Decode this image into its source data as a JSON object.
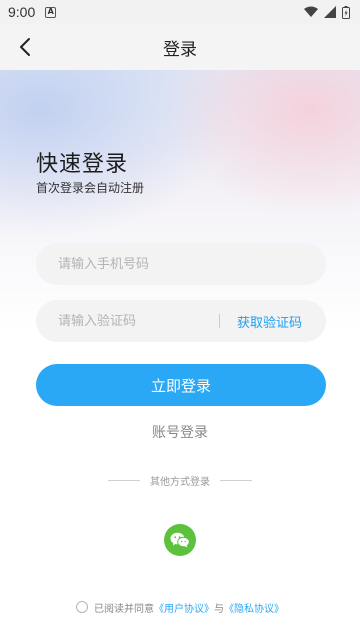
{
  "status_bar": {
    "time": "9:00",
    "notification_glyph": "A"
  },
  "nav": {
    "title": "登录"
  },
  "header": {
    "title": "快速登录",
    "subtitle": "首次登录会自动注册"
  },
  "form": {
    "phone_placeholder": "请输入手机号码",
    "code_placeholder": "请输入验证码",
    "get_code_label": "获取验证码",
    "submit_label": "立即登录",
    "account_login_label": "账号登录"
  },
  "other_login": {
    "label": "其他方式登录"
  },
  "agreement": {
    "prefix": "已阅读并同意",
    "user_agreement": "《用户协议》",
    "connector": "与",
    "privacy_agreement": "《隐私协议》"
  },
  "colors": {
    "accent": "#2aa8f5",
    "wechat": "#5cc23d",
    "input_bg": "#f3f3f3"
  },
  "icons": {
    "back": "chevron-left-icon",
    "wifi": "wifi-icon",
    "signal": "signal-icon",
    "battery": "battery-icon",
    "wechat": "wechat-icon"
  }
}
